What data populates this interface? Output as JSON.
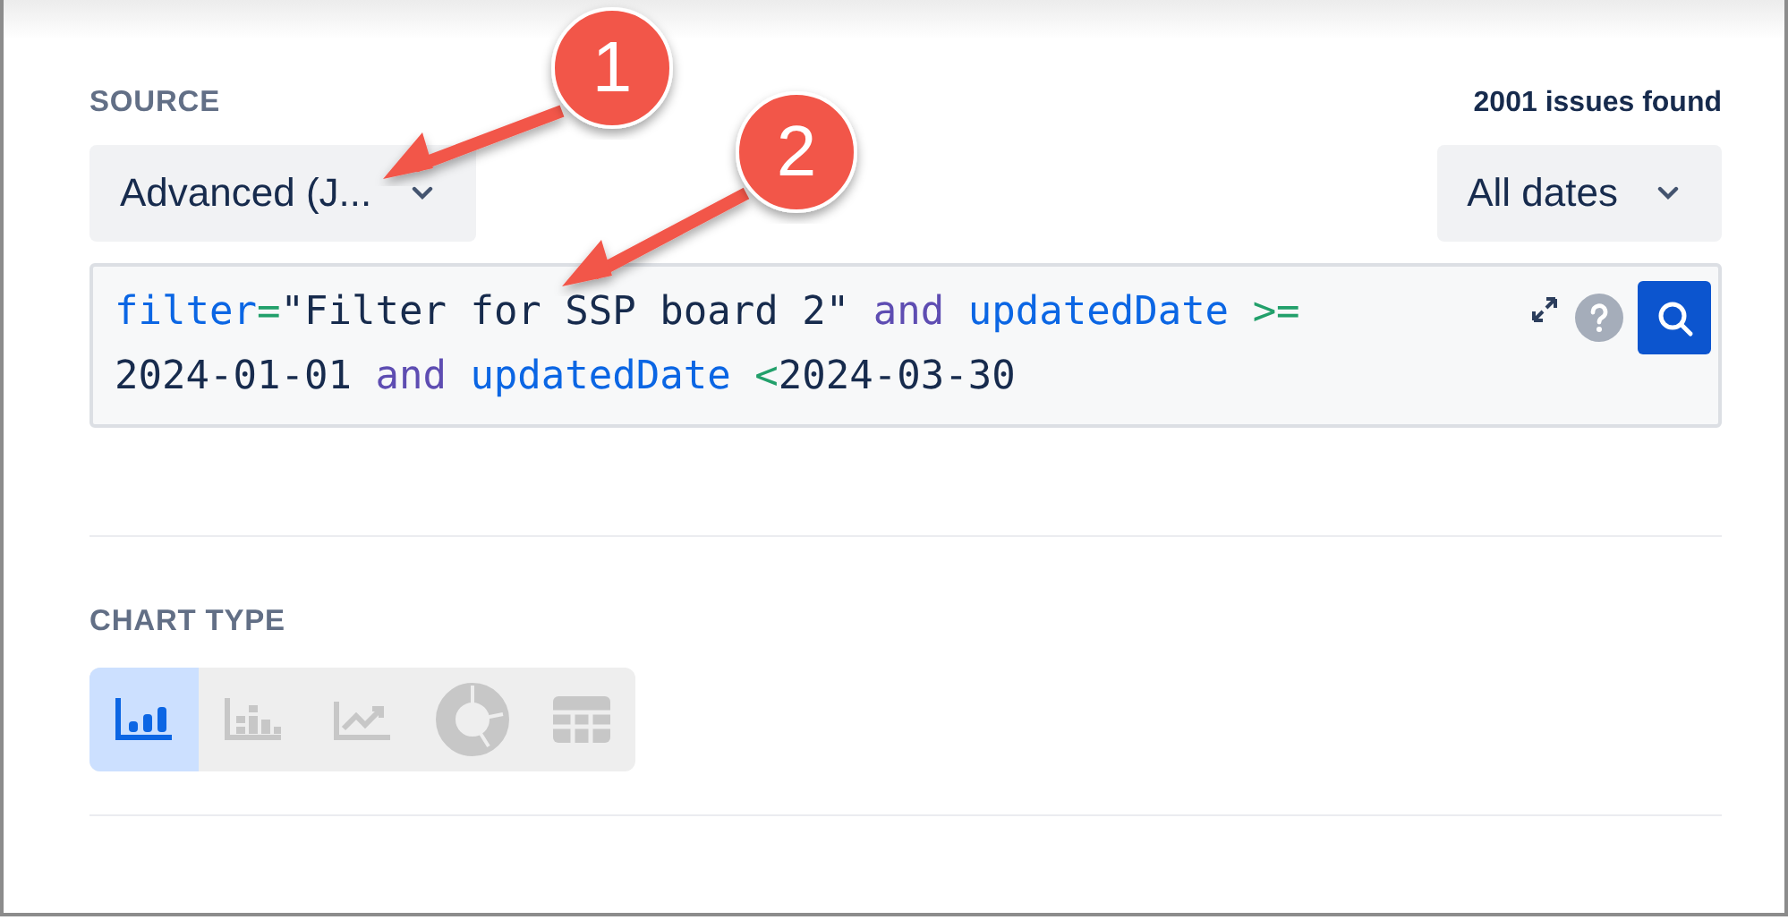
{
  "source": {
    "label": "SOURCE",
    "count": "2001 issues found",
    "mode_dropdown": {
      "value": "Advanced (J..."
    },
    "date_dropdown": {
      "value": "All dates"
    },
    "query": {
      "lines": [
        [
          {
            "kind": "field",
            "text": "filter"
          },
          {
            "kind": "operator",
            "text": "="
          },
          {
            "kind": "string",
            "text": "\"Filter for SSP board 2\" "
          },
          {
            "kind": "keyword",
            "text": "and "
          },
          {
            "kind": "field",
            "text": "updatedDate "
          },
          {
            "kind": "operator",
            "text": ">="
          }
        ],
        [
          {
            "kind": "value",
            "text": "2024-01-01 "
          },
          {
            "kind": "keyword",
            "text": "and "
          },
          {
            "kind": "field",
            "text": "updatedDate "
          },
          {
            "kind": "operator",
            "text": "<"
          },
          {
            "kind": "value",
            "text": "2024-03-30"
          }
        ]
      ]
    }
  },
  "chart_type": {
    "label": "CHART TYPE",
    "options": [
      {
        "kind": "bar",
        "selected": true
      },
      {
        "kind": "stacked",
        "selected": false
      },
      {
        "kind": "line",
        "selected": false
      },
      {
        "kind": "donut",
        "selected": false
      },
      {
        "kind": "table",
        "selected": false
      }
    ]
  },
  "callouts": [
    {
      "number": "1"
    },
    {
      "number": "2"
    }
  ]
}
